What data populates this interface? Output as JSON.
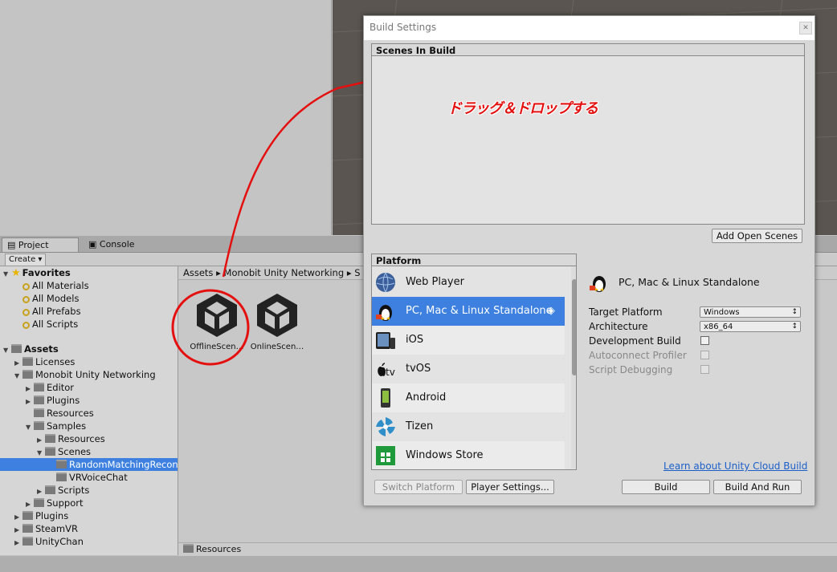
{
  "project_panel": {
    "tabs": [
      {
        "label": "Project"
      },
      {
        "label": "Console"
      }
    ],
    "create_label": "Create",
    "favorites": {
      "label": "Favorites",
      "items": [
        "All Materials",
        "All Models",
        "All Prefabs",
        "All Scripts"
      ]
    },
    "tree": {
      "assets": "Assets",
      "licenses": "Licenses",
      "monobit": "Monobit Unity Networking",
      "editor": "Editor",
      "plugins_sub": "Plugins",
      "resources_sub": "Resources",
      "samples": "Samples",
      "samples_resources": "Resources",
      "scenes": "Scenes",
      "random_matching": "RandomMatchingRecon",
      "vr_voice_chat": "VRVoiceChat",
      "scripts": "Scripts",
      "support": "Support",
      "plugins": "Plugins",
      "steamvr": "SteamVR",
      "unitychan": "UnityChan"
    },
    "breadcrumb": [
      "Assets",
      "Monobit Unity Networking",
      "S"
    ],
    "assets": [
      {
        "label": "OfflineScen…"
      },
      {
        "label": "OnlineScen…"
      }
    ],
    "bottom_path": "Resources"
  },
  "build_settings": {
    "title": "Build Settings",
    "scenes_header": "Scenes In Build",
    "annotation": "ドラッグ＆ドロップする",
    "add_open_scenes": "Add Open Scenes",
    "platform_header": "Platform",
    "platforms": [
      {
        "label": "Web Player",
        "icon": "globe-icon"
      },
      {
        "label": "PC, Mac & Linux Standalone",
        "icon": "linux-penguin-icon",
        "selected": true
      },
      {
        "label": "iOS",
        "icon": "ios-device-icon"
      },
      {
        "label": "tvOS",
        "icon": "apple-tv-icon"
      },
      {
        "label": "Android",
        "icon": "android-phone-icon"
      },
      {
        "label": "Tizen",
        "icon": "tizen-icon"
      },
      {
        "label": "Windows Store",
        "icon": "windows-store-icon"
      }
    ],
    "selected_platform_title": "PC, Mac & Linux Standalone",
    "target_platform_label": "Target Platform",
    "target_platform_value": "Windows",
    "architecture_label": "Architecture",
    "architecture_value": "x86_64",
    "development_build_label": "Development Build",
    "autoconnect_profiler_label": "Autoconnect Profiler",
    "script_debugging_label": "Script Debugging",
    "cloud_link": "Learn about Unity Cloud Build",
    "switch_platform": "Switch Platform",
    "player_settings": "Player Settings...",
    "build": "Build",
    "build_and_run": "Build And Run"
  },
  "colors": {
    "selection": "#3d80df",
    "annotation": "#e41010",
    "link": "#1a5fc9"
  }
}
